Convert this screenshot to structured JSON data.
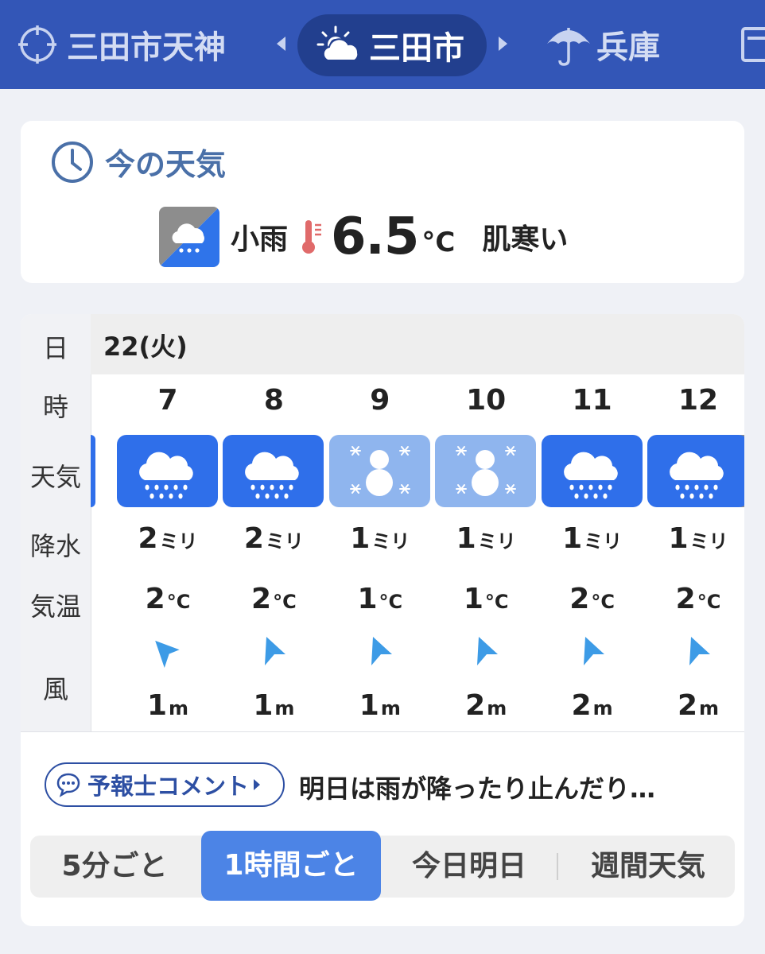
{
  "header": {
    "current_location": "三田市天神",
    "city": "三田市",
    "prefecture": "兵庫"
  },
  "now": {
    "title": "今の天気",
    "condition": "小雨",
    "temperature": "6.5",
    "unit": "°C",
    "feel": "肌寒い"
  },
  "forecast": {
    "labels": {
      "day": "日",
      "hour": "時",
      "weather": "天気",
      "precip": "降水",
      "temp": "気温",
      "wind": "風"
    },
    "date": "22(火)",
    "precip_unit": "ミリ",
    "temp_unit": "°C",
    "wind_unit": "m",
    "hours": [
      {
        "hour": "7",
        "weather": "rain",
        "precip": "2",
        "temp": "2",
        "wind": "1"
      },
      {
        "hour": "8",
        "weather": "rain",
        "precip": "2",
        "temp": "2",
        "wind": "1"
      },
      {
        "hour": "9",
        "weather": "snow",
        "precip": "1",
        "temp": "1",
        "wind": "1"
      },
      {
        "hour": "10",
        "weather": "snow",
        "precip": "1",
        "temp": "1",
        "wind": "2"
      },
      {
        "hour": "11",
        "weather": "rain",
        "precip": "1",
        "temp": "2",
        "wind": "2"
      },
      {
        "hour": "12",
        "weather": "rain",
        "precip": "1",
        "temp": "2",
        "wind": "2"
      }
    ]
  },
  "comment": {
    "button_label": "予報士コメント",
    "text": "明日は雨が降ったり止んだり…"
  },
  "tabs": [
    "5分ごと",
    "1時間ごと",
    "今日明日",
    "週間天気"
  ],
  "colors": {
    "header": "#3356b7",
    "rain_tile": "#2f6fea",
    "snow_tile": "#8fb5ee",
    "accent": "#4c84e6"
  }
}
